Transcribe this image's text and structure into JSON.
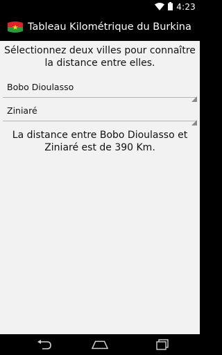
{
  "status_bar": {
    "time": "4:23",
    "wifi_icon": "wifi-icon",
    "battery_icon": "battery-icon"
  },
  "action_bar": {
    "app_icon": "burkina-flag-icon",
    "title": "Tableau Kilométrique du Burkina"
  },
  "main": {
    "instructions": "Sélectionnez deux villes pour connaître la distance entre elles.",
    "city_from": {
      "selected": "Bobo Dioulasso"
    },
    "city_to": {
      "selected": "Ziniaré"
    },
    "result": "La distance entre Bobo Dioulasso et Ziniaré est de 390 Km."
  },
  "nav_bar": {
    "back_icon": "back-icon",
    "home_icon": "home-icon",
    "recents_icon": "recents-icon"
  },
  "colors": {
    "bars": "#000000",
    "background": "#f2f2f2",
    "text": "#111111",
    "flag_red": "#d7262b",
    "flag_green": "#2a9a3a",
    "flag_star": "#f7d117"
  }
}
